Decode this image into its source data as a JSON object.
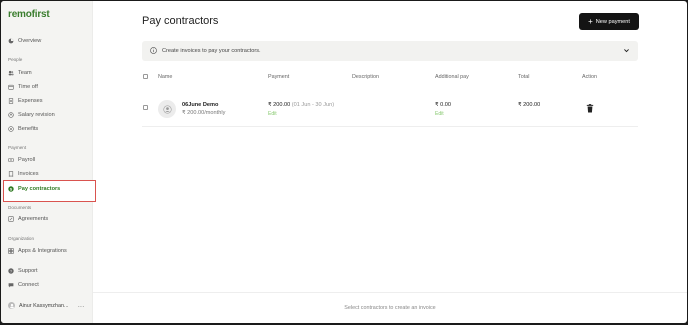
{
  "sidebar": {
    "logo": "remofirst",
    "overview": "Overview",
    "people_label": "People",
    "people": [
      "Team",
      "Time off",
      "Expenses",
      "Salary revision",
      "Benefits"
    ],
    "payment_label": "Payment",
    "payment": [
      "Payroll",
      "Invoices",
      "Pay contractors"
    ],
    "documents_label": "Documents",
    "documents": [
      "Agreements"
    ],
    "organization_label": "Organization",
    "organization": [
      "Apps & Integrations"
    ],
    "support": "Support",
    "connect": "Connect",
    "user_name": "Ainur Kassymzhan...",
    "more": "..."
  },
  "header": {
    "title": "Pay contractors",
    "new_payment": "New payment"
  },
  "banner": {
    "text": "Create invoices to pay your contractors."
  },
  "table": {
    "headers": [
      "Name",
      "Payment",
      "Description",
      "Additional pay",
      "Total",
      "Action"
    ],
    "rows": [
      {
        "name": "06June Demo",
        "rate": "₹ 200.00/monthly",
        "payment": "₹ 200.00",
        "period": "(01 Jun - 30 Jun)",
        "payment_edit": "Edit",
        "description": "",
        "additional_pay": "₹ 0.00",
        "additional_edit": "Edit",
        "total": "₹ 200.00"
      }
    ]
  },
  "footer": {
    "text": "Select contractors to create an invoice"
  },
  "colors": {
    "brand_green": "#3a7d2e",
    "active_green": "#2f7a22",
    "highlight_red": "#d9534f",
    "button_dark": "#141414"
  }
}
